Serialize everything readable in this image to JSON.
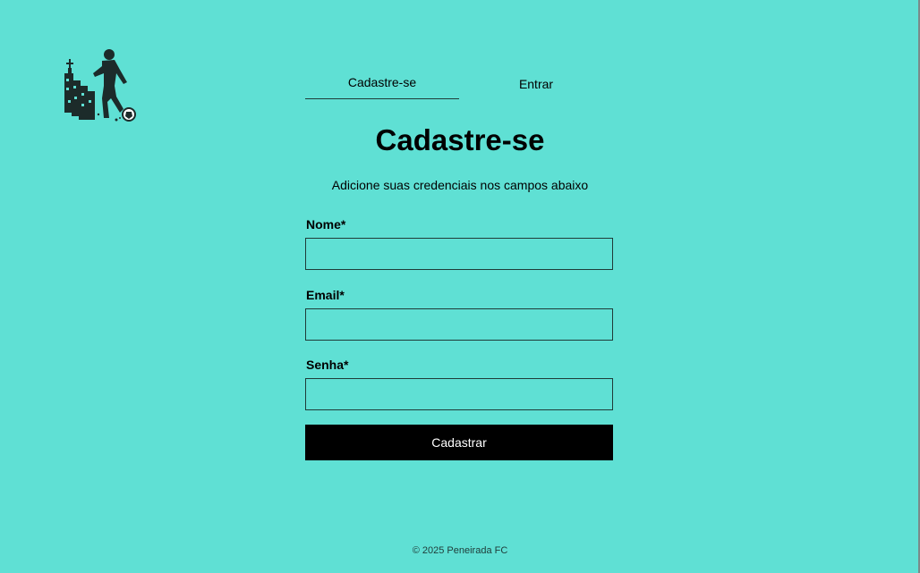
{
  "tabs": {
    "signup_label": "Cadastre-se",
    "login_label": "Entrar",
    "active": "signup"
  },
  "form": {
    "title": "Cadastre-se",
    "subtitle": "Adicione suas credenciais nos campos abaixo",
    "fields": [
      {
        "label": "Nome*",
        "value": ""
      },
      {
        "label": "Email*",
        "value": ""
      },
      {
        "label": "Senha*",
        "value": ""
      }
    ],
    "submit_label": "Cadastrar"
  },
  "footer": {
    "text": "© 2025 Peneirada FC"
  },
  "colors": {
    "background": "#5fe0d4",
    "button": "#000000",
    "button_text": "#ffffff"
  },
  "icons": {
    "logo": "soccer-player-logo-icon"
  }
}
